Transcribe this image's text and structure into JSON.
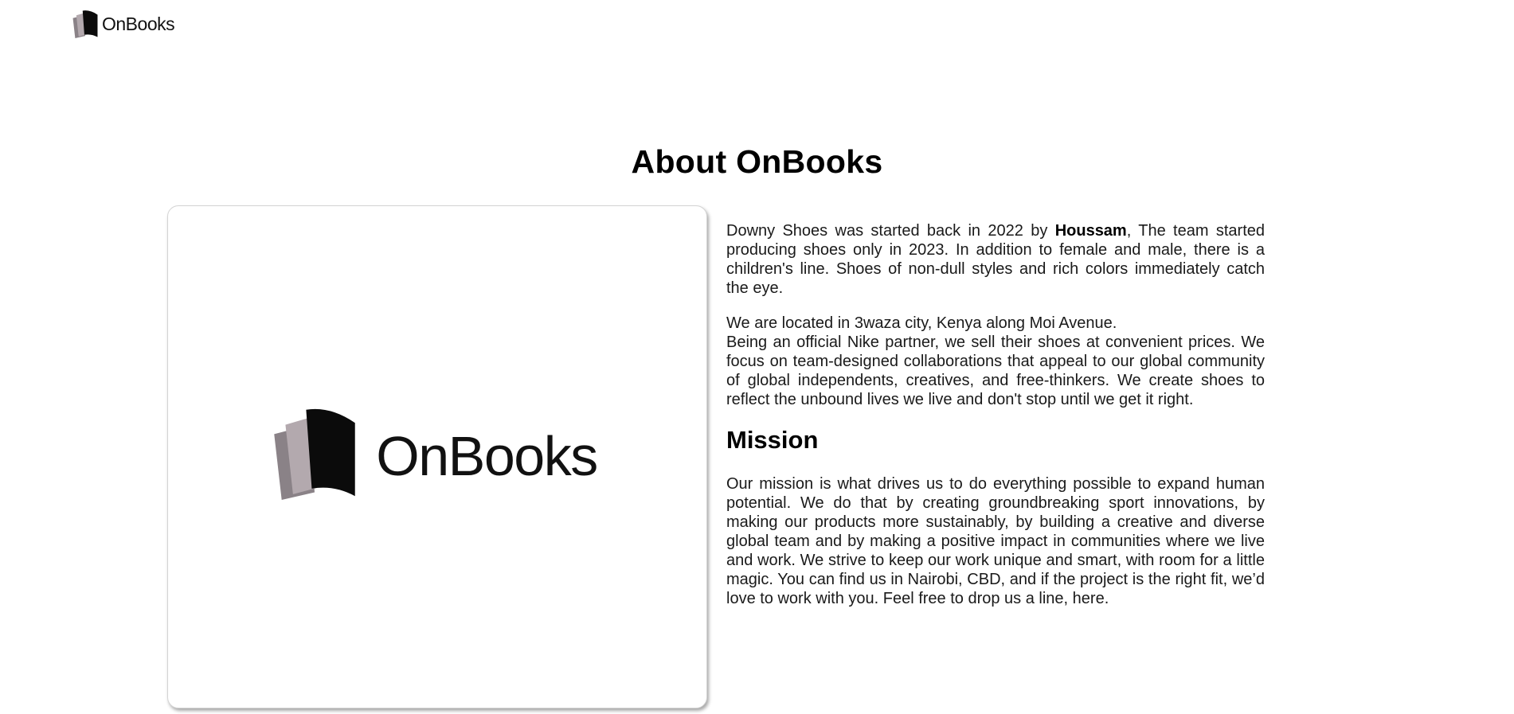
{
  "header": {
    "brand": "OnBooks"
  },
  "page": {
    "title": "About OnBooks"
  },
  "image_card": {
    "logo_text": "OnBooks"
  },
  "about": {
    "intro_before": "Downy Shoes was started back in 2022 by ",
    "intro_bold": "Houssam",
    "intro_after": ", The team started producing shoes only in 2023. In addition to female and male, there is a children's line. Shoes of non-dull styles and rich colors immediately catch the eye.",
    "location": "We are located in 3waza city, Kenya along Moi Avenue.",
    "partner": "Being an official Nike partner, we sell their shoes at convenient prices. We focus on team-designed collaborations that appeal to our global community of global independents, creatives, and free-thinkers. We create shoes to reflect the unbound lives we live and don't stop until we get it right."
  },
  "mission": {
    "heading": "Mission",
    "text": "Our mission is what drives us to do everything possible to expand human potential. We do that by creating groundbreaking sport innovations, by making our products more sustainably, by building a creative and diverse global team and by making a positive impact in communities where we live and work. We strive to keep our work unique and smart, with room for a little magic. You can find us in Nairobi, CBD, and if the project is the right fit, we’d love to work with you. Feel free to drop us a line, here."
  },
  "icons": {
    "logo": "open-book-icon"
  }
}
